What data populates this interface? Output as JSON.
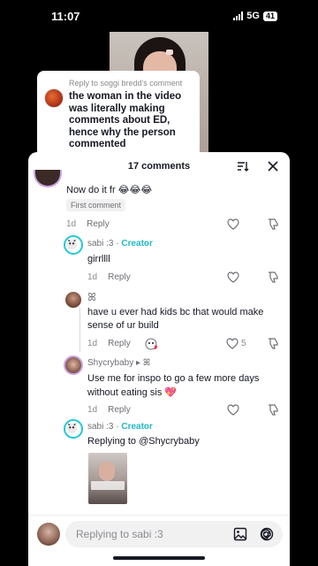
{
  "status_bar": {
    "time": "11:07",
    "network": "5G",
    "battery": "41"
  },
  "reply_card": {
    "reply_to": "Reply to soggi bredd's comment",
    "message": "the woman in the video was literally making comments about ED, hence why the person commented"
  },
  "sheet": {
    "title": "17 comments"
  },
  "comments": {
    "top": {
      "text": "Now do it fr 😂😂😂",
      "pill": "First comment",
      "time": "1d",
      "reply_label": "Reply"
    },
    "creator_reply_1": {
      "name": "sabi :3",
      "badge": "Creator",
      "text": "girrllll",
      "time": "1d",
      "reply_label": "Reply"
    },
    "reply_kids": {
      "name": "ꕤ",
      "line1": "have u ever had kids bc that would make",
      "line2": "sense of ur build",
      "time": "1d",
      "reply_label": "Reply",
      "likes": "5"
    },
    "reply_shycry": {
      "name": "Shycrybaby",
      "arrow": "▸ ꕤ",
      "line1": "Use me for inspo to go a few more days",
      "line2": "without eating sis 💖",
      "time": "1d",
      "reply_label": "Reply"
    },
    "creator_reply_2": {
      "name": "sabi :3",
      "badge": "Creator",
      "text": "Replying to @Shycrybaby"
    }
  },
  "input": {
    "placeholder": "Replying to sabi :3"
  },
  "colors": {
    "creator": "#20b8c7",
    "muted": "#8a8b91",
    "text": "#161823"
  }
}
